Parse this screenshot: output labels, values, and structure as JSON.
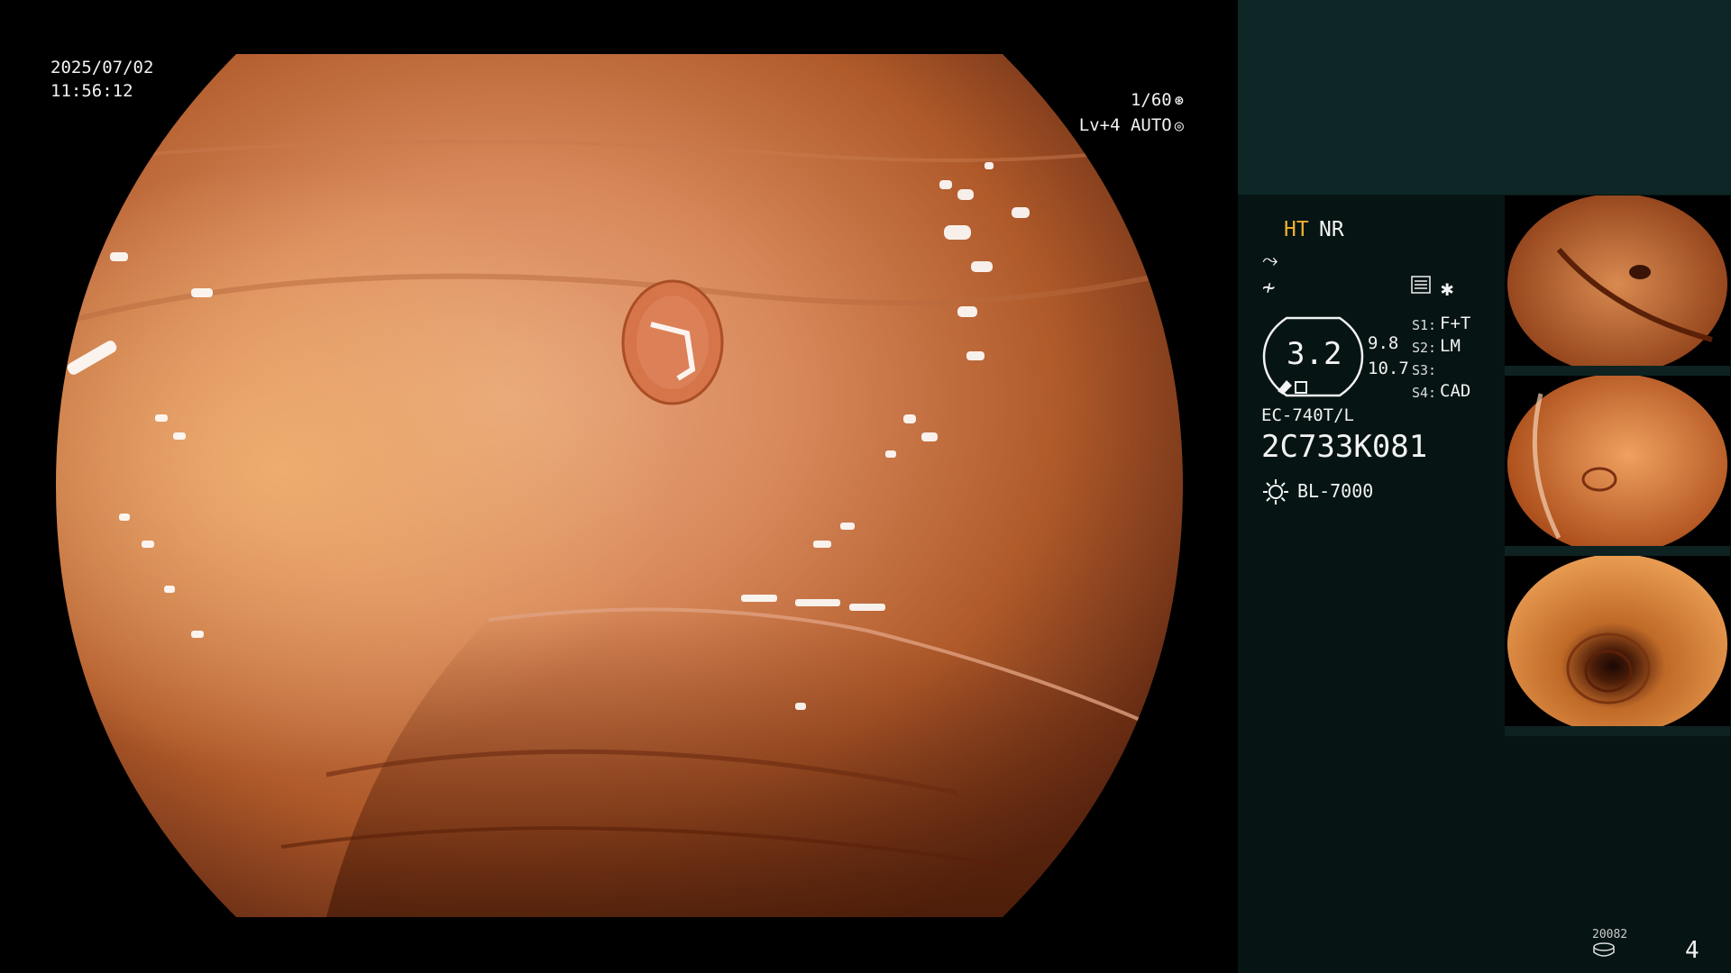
{
  "osd": {
    "date": "2025/07/02",
    "time": "11:56:12",
    "shutter": "1/60",
    "level": "Lv+4 AUTO",
    "shutter_icon": "aperture-icon",
    "auto_icon": "iris-icon"
  },
  "panel": {
    "mode_primary": "HT",
    "mode_secondary": "NR",
    "icons": [
      "wave-enhance-icon",
      "wave-filter-icon",
      "menu-list-icon",
      "asterisk-icon"
    ],
    "zoom_value": "3.2",
    "value_a": "9.8",
    "value_b": "10.7",
    "slots": [
      {
        "label": "S1:",
        "value": "F+T"
      },
      {
        "label": "S2:",
        "value": "LM"
      },
      {
        "label": "S3:",
        "value": ""
      },
      {
        "label": "S4:",
        "value": "CAD"
      }
    ],
    "scope_model": "EC-740T/L",
    "scope_serial": "2C733K081",
    "light_source": "BL-7000",
    "counter": "20082",
    "page_number": "4"
  },
  "colors": {
    "panel_bg": "#061414",
    "panel_header": "#0f2626",
    "highlight_orange": "#f0b030",
    "tissue_orange": "#c8642a"
  }
}
